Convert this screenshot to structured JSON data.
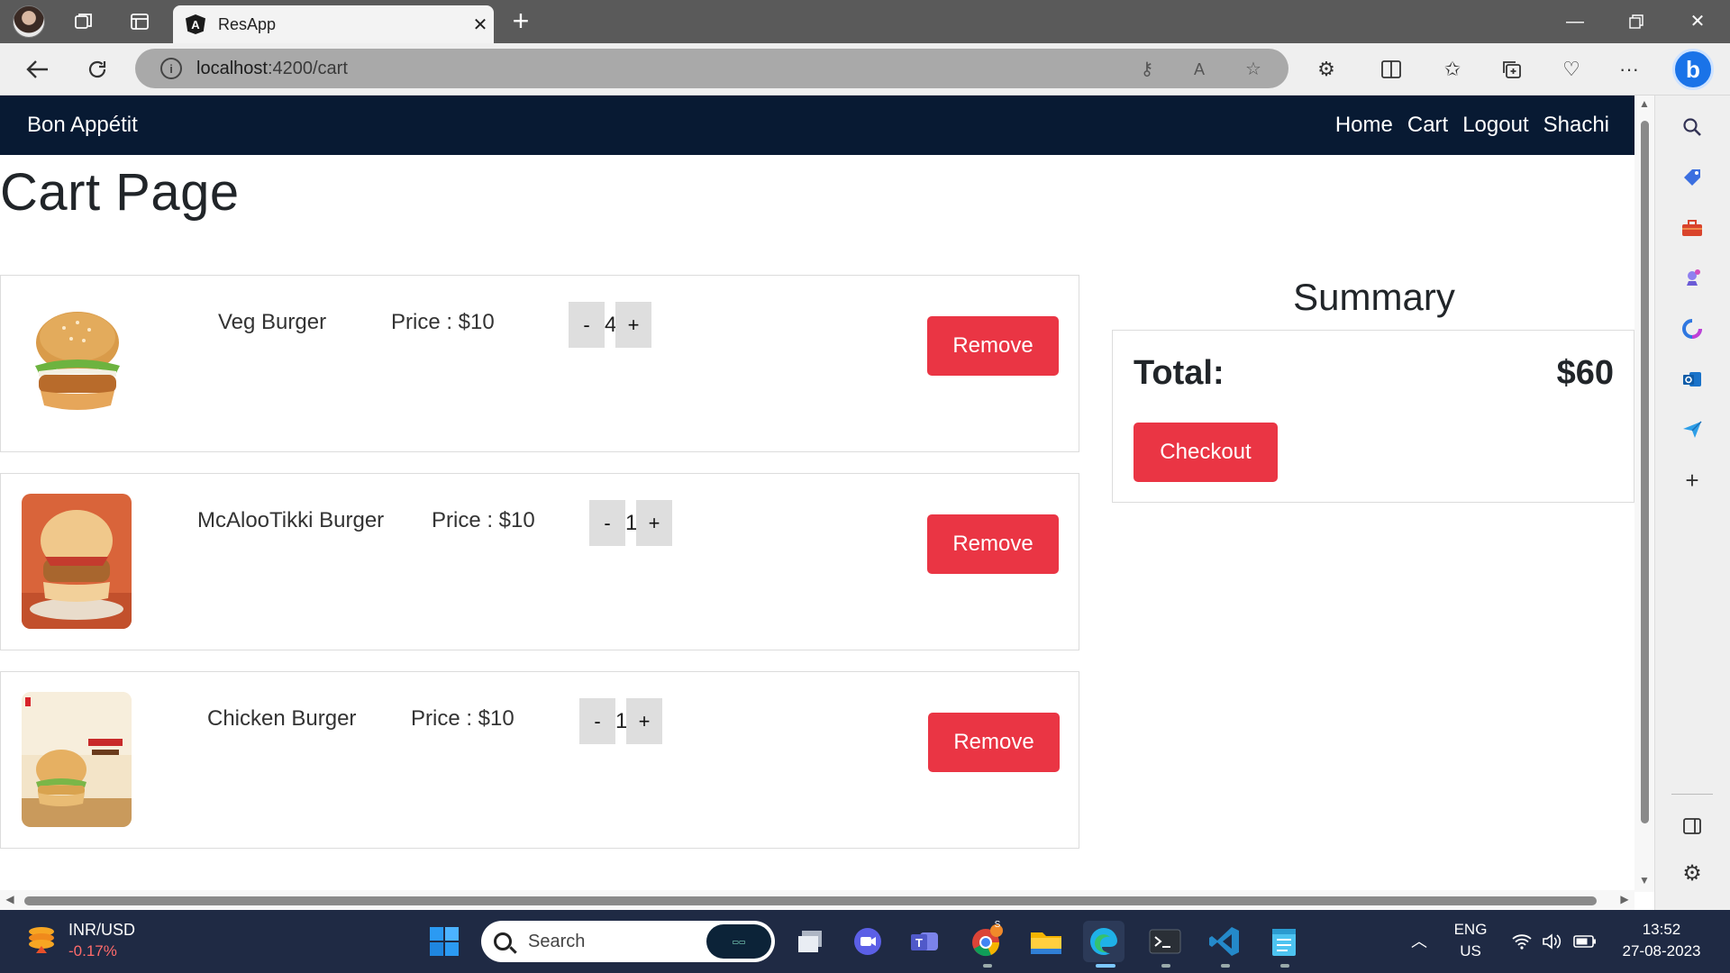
{
  "browser": {
    "tab_title": "ResApp",
    "tab_favicon_letter": "A",
    "url_host": "localhost",
    "url_rest": ":4200/cart"
  },
  "app": {
    "brand": "Bon Appétit",
    "nav": [
      "Home",
      "Cart",
      "Logout",
      "Shachi"
    ]
  },
  "page": {
    "title": "Cart Page"
  },
  "cart": {
    "items": [
      {
        "name": "Veg Burger",
        "price": "Price : $10",
        "quantity": "4",
        "decrement": "-",
        "increment": "+",
        "remove": "Remove",
        "image": "veg-burger-image"
      },
      {
        "name": "McAlooTikki Burger",
        "price": "Price : $10",
        "quantity": "1",
        "decrement": "-",
        "increment": "+",
        "remove": "Remove",
        "image": "mcalootikki-burger-image"
      },
      {
        "name": "Chicken Burger",
        "price": "Price : $10",
        "quantity": "1",
        "decrement": "-",
        "increment": "+",
        "remove": "Remove",
        "image": "chicken-burger-image"
      }
    ]
  },
  "summary": {
    "title": "Summary",
    "total_label": "Total:",
    "total_value": "$60",
    "checkout": "Checkout"
  },
  "taskbar": {
    "stock_name": "INR/USD",
    "stock_change": "-0.17%",
    "search_placeholder": "Search",
    "lang_top": "ENG",
    "lang_bottom": "US",
    "time": "13:52",
    "date": "27-08-2023",
    "chrome_badge": "S"
  },
  "colors": {
    "navbar": "#081a33",
    "danger": "#ea3544",
    "taskbar": "#1f2a44"
  }
}
